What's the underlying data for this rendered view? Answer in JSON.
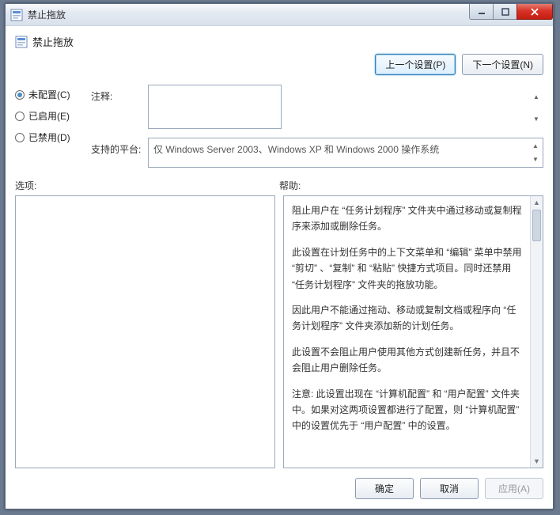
{
  "window": {
    "title": "禁止拖放"
  },
  "header": {
    "title": "禁止拖放"
  },
  "nav": {
    "prev": "上一个设置(P)",
    "next": "下一个设置(N)"
  },
  "radios": {
    "not_configured": "未配置(C)",
    "enabled": "已启用(E)",
    "disabled": "已禁用(D)",
    "selected": "not_configured"
  },
  "fields": {
    "comment_label": "注释:",
    "comment_value": "",
    "platform_label": "支持的平台:",
    "platform_value": "仅 Windows Server 2003、Windows XP 和 Windows 2000 操作系统"
  },
  "lower": {
    "options_label": "选项:",
    "help_label": "帮助:"
  },
  "help": {
    "p1": "阻止用户在 “任务计划程序” 文件夹中通过移动或复制程序来添加或删除任务。",
    "p2": "此设置在计划任务中的上下文菜单和 “编辑” 菜单中禁用 “剪切” 、“复制” 和 “粘贴” 快捷方式项目。同时还禁用 “任务计划程序” 文件夹的拖放功能。",
    "p3": "因此用户不能通过拖动、移动或复制文档或程序向 “任务计划程序” 文件夹添加新的计划任务。",
    "p4": "此设置不会阻止用户使用其他方式创建新任务，并且不会阻止用户删除任务。",
    "p5": "注意: 此设置出现在 “计算机配置” 和 “用户配置” 文件夹中。如果对这两项设置都进行了配置，则 “计算机配置” 中的设置优先于 “用户配置” 中的设置。"
  },
  "footer": {
    "ok": "确定",
    "cancel": "取消",
    "apply": "应用(A)"
  }
}
